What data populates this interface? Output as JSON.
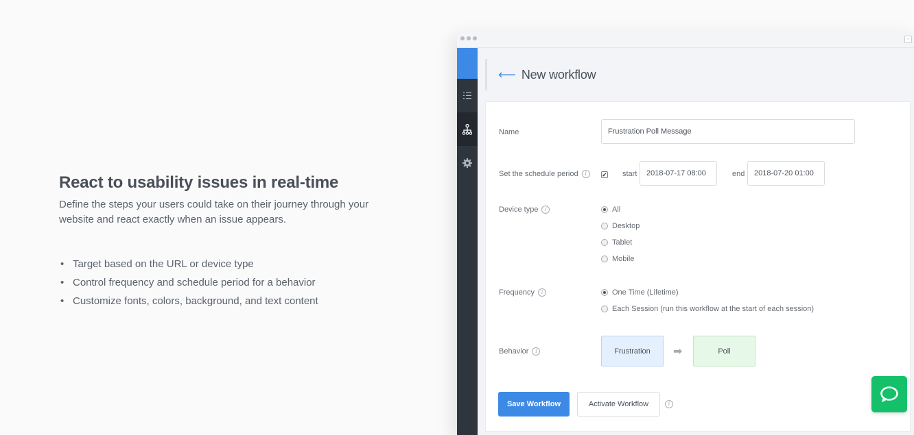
{
  "promo": {
    "heading": "React to usability issues in real-time",
    "description": "Define the steps your users could take on their journey through your website and react exactly when an issue appears.",
    "bullets": [
      "Target based on the URL or device type",
      "Control frequency and schedule period for a behavior",
      "Customize fonts, colors, background, and text content"
    ]
  },
  "icons": {
    "back": "arrow-left-icon",
    "nav_list": "list-icon",
    "nav_workflow": "workflow-tree-icon",
    "nav_settings": "gear-icon",
    "info": "info-icon",
    "behavior_arrow": "arrow-right-icon",
    "chat": "chat-bubble-icon"
  },
  "app": {
    "page_title": "New workflow",
    "form": {
      "name_label": "Name",
      "name_value": "Frustration Poll Message",
      "schedule_label": "Set the schedule period",
      "schedule_checked": true,
      "start_label": "start",
      "start_value": "2018-07-17 08:00",
      "end_label": "end",
      "end_value": "2018-07-20 01:00",
      "device_label": "Device type",
      "device_options": [
        "All",
        "Desktop",
        "Tablet",
        "Mobile"
      ],
      "device_selected": "All",
      "frequency_label": "Frequency",
      "frequency_options": [
        "One Time (Lifetime)",
        "Each Session (run this workflow at the start of each session)"
      ],
      "frequency_selected": "One Time (Lifetime)",
      "behavior_label": "Behavior",
      "behavior_steps": [
        "Frustration",
        "Poll"
      ],
      "save_label": "Save Workflow",
      "activate_label": "Activate Workflow"
    }
  },
  "colors": {
    "accent": "#3d8ae6",
    "sidebar": "#2f353d",
    "chat": "#14c06a",
    "frustration_bg": "#e4f0fd",
    "poll_bg": "#e6f8e8"
  }
}
